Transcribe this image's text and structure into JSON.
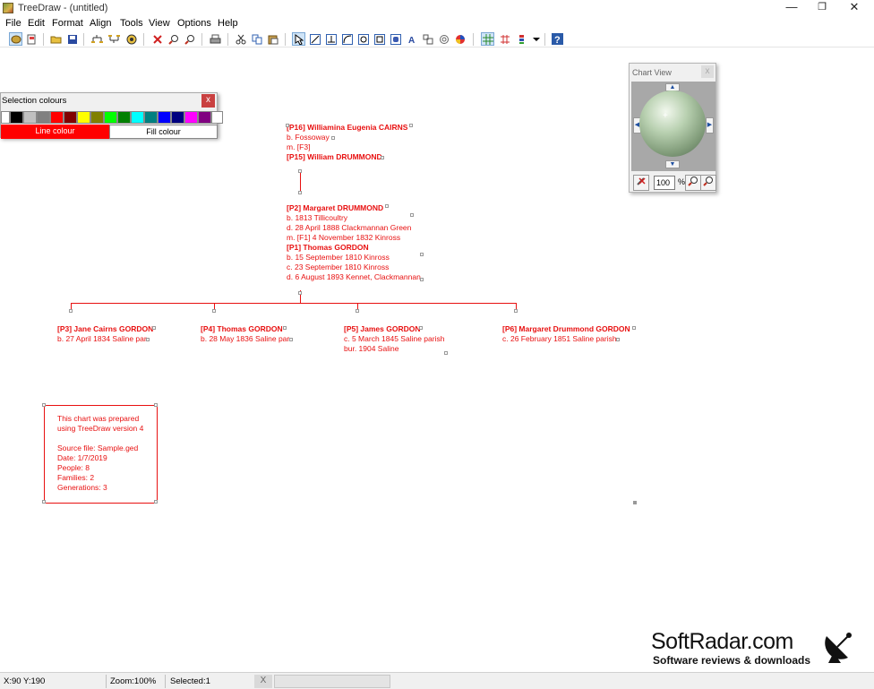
{
  "window": {
    "title": "TreeDraw - (untitled)",
    "minimize": "—",
    "maximize": "❐",
    "close": "✕"
  },
  "menu": [
    "File",
    "Edit",
    "Format",
    "Align",
    "Tools",
    "View",
    "Options",
    "Help"
  ],
  "toolbar": {
    "buttons": [
      "new-chart",
      "wizard",
      "open",
      "save",
      "layout-1",
      "layout-2",
      "target",
      "delete",
      "zoom-in",
      "zoom-out",
      "print",
      "cut",
      "copy",
      "paste",
      "select",
      "line",
      "connector",
      "curve",
      "circle",
      "box-1",
      "box-2",
      "text-a",
      "shape",
      "ring",
      "color-wheel",
      "grid",
      "tree-grid",
      "legend",
      "dropdown",
      "help"
    ]
  },
  "palette": {
    "title": "Selection colours",
    "close": "x",
    "colors": [
      "#ffffff",
      "#000000",
      "#c0c0c0",
      "#808080",
      "#ff0000",
      "#800000",
      "#ffff00",
      "#808000",
      "#00ff00",
      "#008000",
      "#00ffff",
      "#008080",
      "#0000ff",
      "#000080",
      "#ff00ff",
      "#800080",
      "#ffffff",
      "#f0f0f0"
    ],
    "line_tab": "Line colour",
    "fill_tab": "Fill colour"
  },
  "chart_view": {
    "title": "Chart View",
    "close": "x",
    "zoom_value": "100",
    "zoom_unit": "%"
  },
  "chart": {
    "grandparents": [
      {
        "text": "[P16] Williamina Eugenia CAIRNS",
        "bold": true
      },
      {
        "text": "b.  Fossoway"
      },
      {
        "text": "m. [F3]"
      },
      {
        "text": "[P15] William DRUMMOND",
        "bold": true
      }
    ],
    "parents": [
      {
        "text": "[P2] Margaret DRUMMOND",
        "bold": true
      },
      {
        "text": "b. 1813 Tillicoultry"
      },
      {
        "text": "d. 28 April 1888 Clackmannan Green"
      },
      {
        "text": "m. [F1] 4 November 1832 Kinross"
      },
      {
        "text": "[P1] Thomas GORDON",
        "bold": true
      },
      {
        "text": "b. 15 September 1810 Kinross"
      },
      {
        "text": "c. 23 September 1810 Kinross"
      },
      {
        "text": "d. 6 August 1893 Kennet, Clackmannan"
      }
    ],
    "children": [
      {
        "name": "[P3] Jane Cairns GORDON",
        "lines": [
          "b. 27 April 1834 Saline par"
        ]
      },
      {
        "name": "[P4] Thomas GORDON",
        "lines": [
          "b. 28 May 1836 Saline par"
        ]
      },
      {
        "name": "[P5] James GORDON",
        "lines": [
          "c. 5 March 1845 Saline parish",
          "bur. 1904 Saline"
        ]
      },
      {
        "name": "[P6] Margaret Drummond GORDON",
        "lines": [
          "c. 26 February 1851 Saline parish"
        ]
      }
    ],
    "info": [
      "This chart was prepared",
      "using TreeDraw version 4",
      "",
      "Source file: Sample.ged",
      "Date: 1/7/2019",
      "People: 8",
      "Families: 2",
      "Generations: 3"
    ]
  },
  "status": {
    "coords": "X:90  Y:190",
    "zoom": "Zoom:100%",
    "selected": "Selected:1",
    "x_button": "X"
  },
  "watermark": {
    "title": "SoftRadar.com",
    "subtitle": "Software reviews & downloads"
  }
}
